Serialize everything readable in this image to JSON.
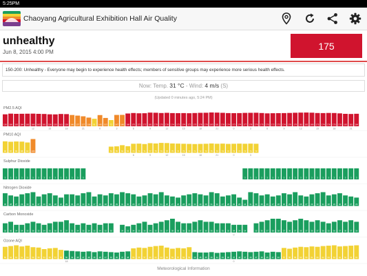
{
  "status_bar": {
    "time": "5:25PM"
  },
  "app": {
    "title": "Chaoyang Agricultural Exhibition Hall Air Quality"
  },
  "actions": [
    {
      "name": "location-pin",
      "icon": "location-pin-icon"
    },
    {
      "name": "refresh",
      "icon": "refresh-icon"
    },
    {
      "name": "share",
      "icon": "share-icon"
    },
    {
      "name": "settings",
      "icon": "gear-icon"
    }
  ],
  "summary": {
    "level": "unhealthy",
    "date": "Jun 8, 2015 4:00 PM",
    "aqi": "175",
    "aqi_color": "#d0142e"
  },
  "description": "150-200: Unhealthy - Everyone may begin to experience health effects; members of sensitive groups may experience more serious health effects.",
  "weather": {
    "temp_label": "Now: Temp.",
    "temp_value": "31 °C",
    "wind_label": "- Wind:",
    "wind_value": "4 m/s",
    "wind_dir": "(S)"
  },
  "updated": "(Updated 0 minutes ago, 5:24 PM)",
  "footer": "Meteorological Information",
  "colors": {
    "good": "#1a9e5e",
    "moderate": "#f2d234",
    "usg": "#f08a2a",
    "unhealthy": "#d0142e"
  },
  "charts": [
    {
      "title": "PM2.5 AQI",
      "values": [
        156,
        166,
        163,
        164,
        165,
        166,
        163,
        161,
        156,
        155,
        161,
        159,
        146,
        137,
        127,
        108,
        91,
        145,
        103,
        72,
        147,
        148,
        168,
        175,
        171,
        172,
        181,
        179,
        175,
        178,
        174,
        173,
        174,
        172,
        175,
        178,
        179,
        183,
        181,
        178,
        174,
        173,
        174,
        177,
        178,
        179,
        175,
        170,
        172,
        173,
        174,
        176,
        179,
        181,
        182,
        180,
        175,
        174,
        176,
        175,
        170,
        163,
        161,
        164
      ],
      "hours": [
        {
          "i": 5,
          "label": "12"
        },
        {
          "i": 8,
          "label": "15"
        },
        {
          "i": 11,
          "label": "18"
        },
        {
          "i": 14,
          "label": "21"
        },
        {
          "i": 17,
          "label": "0"
        },
        {
          "i": 20,
          "label": "3"
        },
        {
          "i": 23,
          "label": "6"
        },
        {
          "i": 26,
          "label": "9"
        },
        {
          "i": 29,
          "label": "12"
        },
        {
          "i": 32,
          "label": "15"
        },
        {
          "i": 35,
          "label": "18"
        },
        {
          "i": 38,
          "label": "21"
        },
        {
          "i": 41,
          "label": "0"
        },
        {
          "i": 44,
          "label": "3"
        },
        {
          "i": 47,
          "label": "6"
        },
        {
          "i": 50,
          "label": "9"
        },
        {
          "i": 53,
          "label": "12"
        },
        {
          "i": 56,
          "label": "15"
        },
        {
          "i": 59,
          "label": "18"
        },
        {
          "i": 62,
          "label": "21"
        }
      ]
    },
    {
      "title": "PM10 AQI",
      "values": [
        90,
        87,
        89,
        88,
        82,
        106,
        null,
        null,
        null,
        null,
        null,
        null,
        null,
        null,
        null,
        null,
        null,
        null,
        null,
        53,
        55,
        63,
        56,
        73,
        74,
        71,
        77,
        75,
        79,
        78,
        75,
        74,
        73,
        72,
        71,
        72,
        73,
        75,
        73,
        74,
        72,
        73,
        74,
        73,
        74,
        73,
        null,
        null,
        null,
        null,
        null,
        null,
        null,
        null,
        null,
        null,
        null,
        null,
        null,
        null,
        null,
        null,
        null,
        null
      ],
      "hours": [
        {
          "i": 23,
          "label": "6"
        },
        {
          "i": 26,
          "label": "9"
        },
        {
          "i": 29,
          "label": "12"
        },
        {
          "i": 32,
          "label": "15"
        },
        {
          "i": 35,
          "label": "18"
        },
        {
          "i": 38,
          "label": "21"
        },
        {
          "i": 41,
          "label": "0"
        },
        {
          "i": 44,
          "label": "3"
        }
      ]
    },
    {
      "title": "Sulphur Dioxide",
      "values": [
        3,
        3,
        3,
        3,
        3,
        3,
        3,
        3,
        3,
        3,
        3,
        3,
        3,
        3,
        3,
        null,
        null,
        null,
        null,
        null,
        null,
        null,
        null,
        null,
        null,
        null,
        null,
        null,
        null,
        null,
        null,
        null,
        null,
        null,
        null,
        null,
        null,
        null,
        null,
        null,
        null,
        null,
        null,
        3,
        3,
        3,
        3,
        3,
        3,
        3,
        3,
        3,
        3,
        3,
        3,
        3,
        3,
        3,
        3,
        3,
        3,
        3,
        3,
        3
      ],
      "hours": []
    },
    {
      "title": "Nitrogen Dioxide",
      "values": [
        30,
        28,
        27,
        29,
        30,
        31,
        27,
        29,
        30,
        28,
        26,
        29,
        29,
        28,
        30,
        31,
        27,
        29,
        28,
        30,
        29,
        31,
        30,
        29,
        27,
        28,
        30,
        29,
        31,
        28,
        27,
        26,
        28,
        29,
        30,
        29,
        28,
        31,
        30,
        27,
        28,
        29,
        26,
        24,
        31,
        30,
        28,
        29,
        27,
        28,
        30,
        29,
        31,
        28,
        27,
        29,
        30,
        31,
        28,
        29,
        30,
        28,
        27,
        26
      ],
      "hours": []
    },
    {
      "title": "Carbon Monoxide",
      "values": [
        35,
        36,
        34,
        34,
        35,
        36,
        35,
        34,
        35,
        36,
        36,
        37,
        35,
        34,
        35,
        34,
        35,
        34,
        35,
        35,
        null,
        34,
        33,
        34,
        35,
        36,
        34,
        35,
        36,
        37,
        38,
        36,
        35,
        35,
        36,
        37,
        36,
        36,
        35,
        35,
        35,
        34,
        34,
        34,
        null,
        35,
        36,
        37,
        38,
        38,
        37,
        36,
        37,
        38,
        37,
        36,
        37,
        36,
        35,
        36,
        37,
        36,
        37,
        36
      ],
      "hours": [
        {
          "i": 41,
          "label": "0"
        }
      ]
    },
    {
      "title": "Ozone AQI",
      "values": [
        60,
        62,
        64,
        61,
        63,
        59,
        58,
        54,
        56,
        57,
        52,
        50,
        49,
        48,
        47,
        48,
        46,
        48,
        47,
        46,
        45,
        47,
        48,
        56,
        58,
        57,
        60,
        62,
        63,
        58,
        55,
        57,
        56,
        59,
        46,
        45,
        45,
        46,
        44,
        45,
        46,
        47,
        48,
        47,
        46,
        47,
        48,
        45,
        47,
        46,
        57,
        55,
        58,
        60,
        59,
        61,
        60,
        62,
        63,
        64,
        61,
        62,
        63,
        64
      ],
      "hours": [
        {
          "i": 11,
          "label": "18"
        },
        {
          "i": 41,
          "label": "0"
        }
      ]
    }
  ]
}
